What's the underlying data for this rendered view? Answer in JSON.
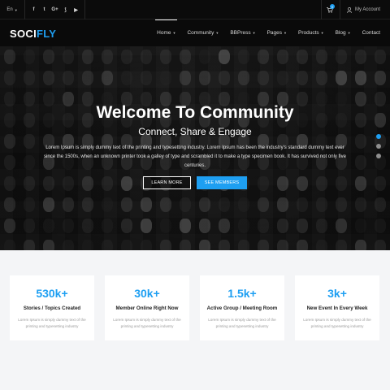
{
  "topbar": {
    "language": "En",
    "social_icons": [
      "facebook-icon",
      "twitter-icon",
      "google-plus-icon",
      "rss-icon",
      "youtube-icon"
    ],
    "social_glyphs": [
      "f",
      "t",
      "G+",
      "⟆",
      "▶"
    ],
    "cart_count": "0",
    "account_label": "My Account"
  },
  "nav": {
    "logo_main": "SOCI",
    "logo_accent": "FLY",
    "items": [
      {
        "label": "Home",
        "caret": true,
        "active": true
      },
      {
        "label": "Community",
        "caret": true
      },
      {
        "label": "BBPress",
        "caret": true
      },
      {
        "label": "Pages",
        "caret": true
      },
      {
        "label": "Products",
        "caret": true
      },
      {
        "label": "Blog",
        "caret": true
      },
      {
        "label": "Contact",
        "caret": false
      }
    ]
  },
  "hero": {
    "title": "Welcome To Community",
    "subtitle": "Connect, Share & Engage",
    "text": "Lorem Ipsum is simply dummy text of the printing and typesetting industry. Lorem Ipsum has been the industry's standard dummy text ever since the 1500s, when an unknown printer took a galley of type and scrambled it to make a type specimen book. It has survived not only five centuries.",
    "learn_more": "LEARN MORE",
    "see_members": "SEE MEMBERS",
    "slider_active_index": 0
  },
  "stats": [
    {
      "value": "530k+",
      "title": "Stories / Topics Created",
      "desc": "Lorem Ipsum is simply dummy text of the printing and typesetting industry"
    },
    {
      "value": "30k+",
      "title": "Member Online Right Now",
      "desc": "Lorem Ipsum is simply dummy text of the printing and typesetting industry"
    },
    {
      "value": "1.5k+",
      "title": "Active Group / Meeting Room",
      "desc": "Lorem Ipsum is simply dummy text of the printing and typesetting industry"
    },
    {
      "value": "3k+",
      "title": "New Event In Every Week",
      "desc": "Lorem Ipsum is simply dummy text of the printing and typesetting industry"
    }
  ],
  "colors": {
    "accent": "#1e9ff2",
    "dark": "#0a0a0a",
    "stats_bg": "#f4f5f7"
  }
}
